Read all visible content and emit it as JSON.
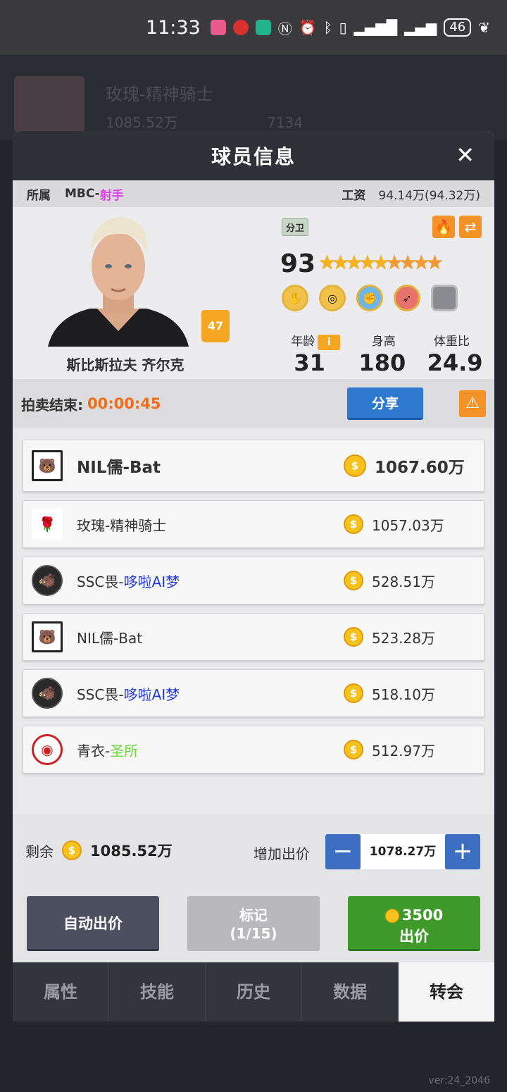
{
  "status_bar": {
    "time": "11:33",
    "battery": "46"
  },
  "modal": {
    "title": "球员信息",
    "close_icon": "close-icon"
  },
  "team_info": {
    "label": "所属",
    "team_prefix": "MBC-",
    "team_role": "射手",
    "salary_label": "工资",
    "salary_value": "94.14万(94.32万)"
  },
  "player": {
    "name": "斯比斯拉夫 齐尔克",
    "jersey_number": "47",
    "position": "分卫",
    "rating": "93",
    "stars": 9,
    "skills": [
      "skill-badge-1",
      "skill-badge-2",
      "skill-badge-3",
      "skill-badge-4",
      "skill-badge-locked"
    ],
    "age_label": "年龄",
    "height_label": "身高",
    "weight_ratio_label": "体重比",
    "age": "31",
    "height": "180",
    "weight_ratio": "24.9"
  },
  "auction": {
    "label": "拍卖结束:",
    "timer": "00:00:45",
    "share_label": "分享"
  },
  "bids": [
    {
      "team": "NIL儒-Bat",
      "team_main": "NIL儒-Bat",
      "team_sub": "",
      "amount": "1067.60万",
      "logo": "bear"
    },
    {
      "team": "玫瑰-精神骑士",
      "team_main": "玫瑰-精神骑士",
      "team_sub": "",
      "amount": "1057.03万",
      "logo": "rose"
    },
    {
      "team": "SSC畏-哆啦AI梦",
      "team_main": "SSC畏-",
      "team_sub": "哆啦AI梦",
      "amount": "528.51万",
      "logo": "boar"
    },
    {
      "team": "NIL儒-Bat",
      "team_main": "NIL儒-Bat",
      "team_sub": "",
      "amount": "523.28万",
      "logo": "bear"
    },
    {
      "team": "SSC畏-哆啦AI梦",
      "team_main": "SSC畏-",
      "team_sub": "哆啦AI梦",
      "amount": "518.10万",
      "logo": "boar"
    },
    {
      "team": "青衣-圣所",
      "team_main": "青衣-",
      "team_sub": "圣所",
      "amount": "512.97万",
      "logo": "qing"
    }
  ],
  "controls": {
    "remaining_label": "剩余",
    "remaining_value": "1085.52万",
    "add_bid_label": "增加出价",
    "bid_value": "1078.27万",
    "auto_bid_label": "自动出价",
    "mark_label": "标记",
    "mark_count": "(1/15)",
    "bid_cost": "3500",
    "bid_label": "出价"
  },
  "tabs": [
    "属性",
    "技能",
    "历史",
    "数据",
    "转会"
  ],
  "active_tab": "转会",
  "version": "ver:24_2046",
  "background": {
    "title": "玫瑰-精神骑士",
    "coins": "1085.52万",
    "gems": "7134"
  },
  "colors": {
    "accent_blue": "#2f78d0",
    "bid_green": "#3f9a2a",
    "timer_orange": "#f06e1a",
    "role_magenta": "#e040e8"
  }
}
